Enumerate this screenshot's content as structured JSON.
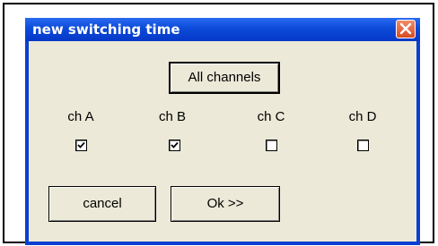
{
  "dialog": {
    "title": "new switching time",
    "all_channels_label": "All channels",
    "cancel_label": "cancel",
    "ok_label": "Ok >>"
  },
  "channels": [
    {
      "label": "ch A",
      "checked": true
    },
    {
      "label": "ch B",
      "checked": true
    },
    {
      "label": "ch C",
      "checked": false
    },
    {
      "label": "ch D",
      "checked": false
    }
  ],
  "icons": {
    "close": "close-icon",
    "check": "checkmark-icon"
  },
  "colors": {
    "titlebar": "#0c4ad8",
    "client": "#ece9d8",
    "close_button": "#d84a22"
  }
}
